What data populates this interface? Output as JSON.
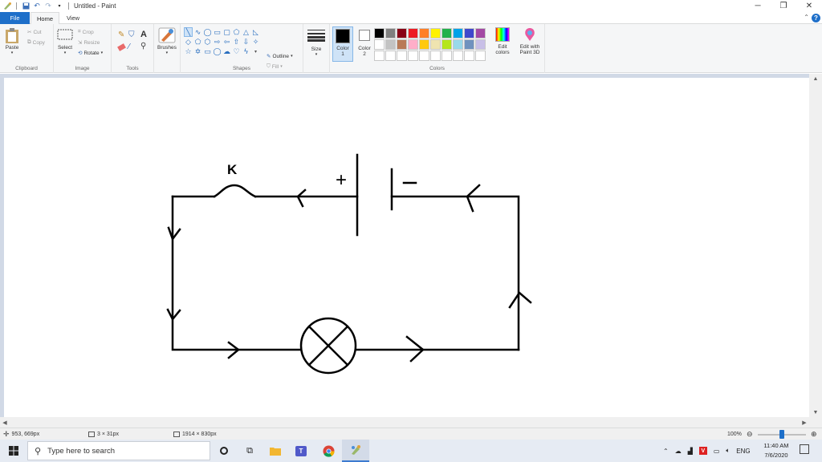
{
  "window": {
    "title": "Untitled - Paint",
    "controls": {
      "minimize": "─",
      "restore": "❐",
      "close": "✕"
    }
  },
  "menu": {
    "tabs": [
      {
        "label": "File"
      },
      {
        "label": "Home"
      },
      {
        "label": "View"
      }
    ],
    "active_tab": "Home",
    "help": "?"
  },
  "ribbon": {
    "clipboard": {
      "label": "Clipboard",
      "paste": "Paste",
      "cut": "Cut",
      "copy": "Copy"
    },
    "image": {
      "label": "Image",
      "select": "Select",
      "crop": "Crop",
      "resize": "Resize",
      "rotate": "Rotate"
    },
    "tools": {
      "label": "Tools"
    },
    "brushes": {
      "label": "Brushes"
    },
    "shapes": {
      "label": "Shapes",
      "outline": "Outline",
      "fill": "Fill"
    },
    "size": {
      "label": "Size"
    },
    "colors": {
      "label": "Colors",
      "color1": "Color",
      "color1_num": "1",
      "color2": "Color",
      "color2_num": "2",
      "edit_colors": "Edit",
      "edit_colors_2": "colors",
      "edit_paint3d": "Edit with",
      "edit_paint3d_2": "Paint 3D",
      "color1_value": "#000000",
      "color2_value": "#ffffff",
      "palette": [
        "#000000",
        "#7f7f7f",
        "#880015",
        "#ed1c24",
        "#ff7f27",
        "#fff200",
        "#22b14c",
        "#00a2e8",
        "#3f48cc",
        "#a349a4",
        "#ffffff",
        "#c3c3c3",
        "#b97a57",
        "#ffaec9",
        "#ffc90e",
        "#efe4b0",
        "#b5e61d",
        "#99d9ea",
        "#7092be",
        "#c8bfe7",
        "#ffffff",
        "#ffffff",
        "#ffffff",
        "#ffffff",
        "#ffffff",
        "#ffffff",
        "#ffffff",
        "#ffffff",
        "#ffffff",
        "#ffffff"
      ]
    }
  },
  "drawing": {
    "switch_label": "K",
    "battery_plus": "+",
    "battery_minus": "−"
  },
  "status": {
    "cursor_position": "953, 669px",
    "selection_size": "3 × 31px",
    "canvas_size": "1914 × 830px",
    "zoom": "100%"
  },
  "taskbar": {
    "search_placeholder": "Type here to search",
    "language": "ENG",
    "time": "11:40 AM",
    "date": "7/6/2020"
  }
}
